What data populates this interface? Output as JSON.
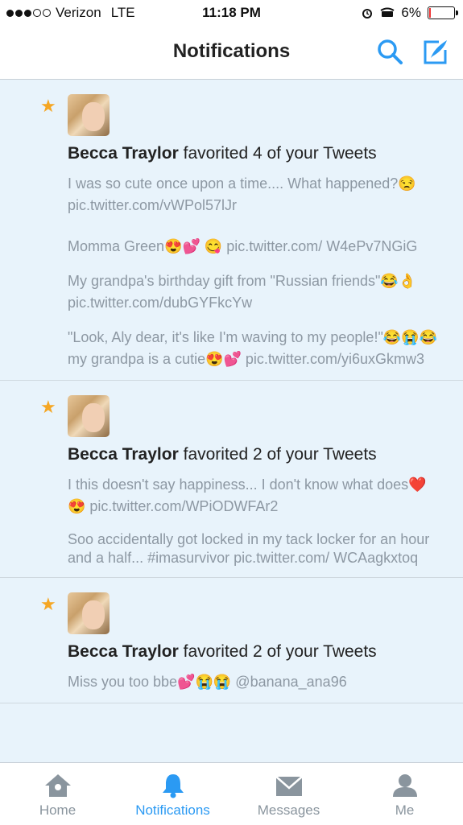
{
  "statusbar": {
    "carrier": "Verizon",
    "network": "LTE",
    "time": "11:18 PM",
    "battery": "6%"
  },
  "header": {
    "title": "Notifications"
  },
  "notifications": [
    {
      "name": "Becca Traylor",
      "action": "favorited 4 of your Tweets",
      "tweets": [
        "I was so cute once upon a time.... What happened?😒 pic.twitter.com/vWPol57lJr",
        "Momma Green😍💕 😋 pic.twitter.com/ W4ePv7NGiG",
        "My grandpa's birthday gift from \"Russian friends\"😂👌 pic.twitter.com/dubGYFkcYw",
        "\"Look, Aly dear, it's like I'm waving to my people!\"😂😭😂 my grandpa is a cutie😍💕 pic.twitter.com/yi6uxGkmw3"
      ]
    },
    {
      "name": "Becca Traylor",
      "action": "favorited 2 of your Tweets",
      "tweets": [
        "I this doesn't say happiness... I don't know what does❤️😍 pic.twitter.com/WPiODWFAr2",
        "Soo accidentally got locked in my tack locker for an hour and a half... #imasurvivor pic.twitter.com/ WCAagkxtoq"
      ]
    },
    {
      "name": "Becca Traylor",
      "action": "favorited 2 of your Tweets",
      "tweets": [
        "Miss you too bbe💕😭😭 @banana_ana96"
      ]
    }
  ],
  "tabs": [
    {
      "label": "Home"
    },
    {
      "label": "Notifications"
    },
    {
      "label": "Messages"
    },
    {
      "label": "Me"
    }
  ],
  "colors": {
    "accent": "#2b9af3",
    "star": "#f5a623",
    "feed_bg": "#e8f3fb",
    "muted": "#8d98a3"
  }
}
